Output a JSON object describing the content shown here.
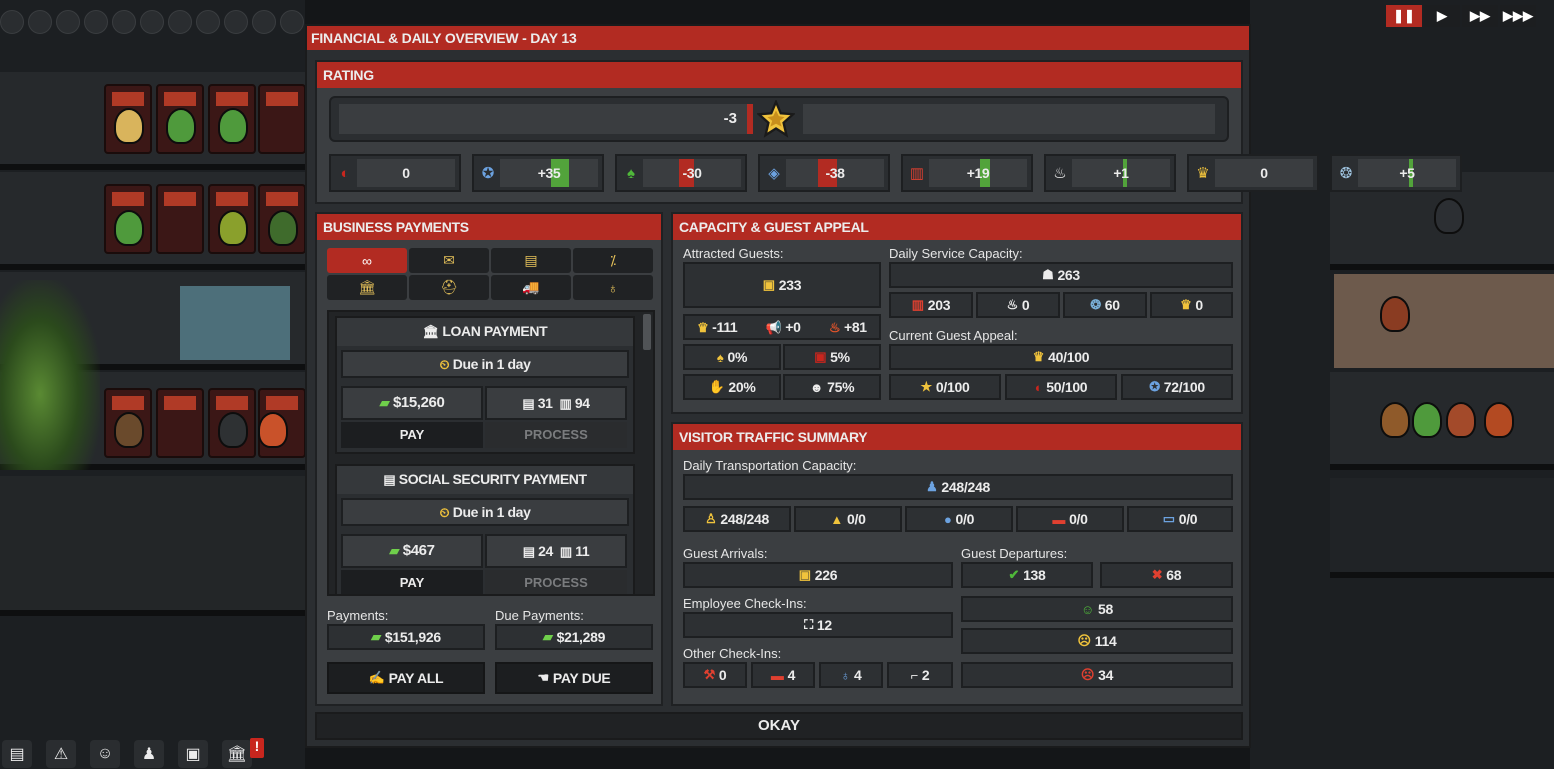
{
  "game": {
    "speed_controls": [
      "❚❚",
      "▶",
      "▶▶",
      "▶▶▶"
    ],
    "speed_active": 0,
    "alert_mark": "!"
  },
  "modal": {
    "title": "FINANCIAL & DAILY OVERVIEW - DAY 13",
    "okay_label": "OKAY"
  },
  "rating": {
    "title": "RATING",
    "overall": "-3",
    "overall_value": -3,
    "stats": [
      {
        "icon": "faction-icon",
        "glyph": "◐",
        "value": "0",
        "bar": 0
      },
      {
        "icon": "police-badge-icon",
        "glyph": "✪",
        "value": "+35",
        "bar": 35
      },
      {
        "icon": "leaf-icon",
        "glyph": "♠",
        "value": "-30",
        "bar": -30
      },
      {
        "icon": "diamond-icon",
        "glyph": "◈",
        "value": "-38",
        "bar": -38
      },
      {
        "icon": "popcorn-icon",
        "glyph": "▥",
        "value": "+19",
        "bar": 19
      },
      {
        "icon": "chef-hat-icon",
        "glyph": "♨",
        "value": "+1",
        "bar": 1
      },
      {
        "icon": "cake-icon",
        "glyph": "♛",
        "value": "0",
        "bar": 0
      },
      {
        "icon": "brain-icon",
        "glyph": "❂",
        "value": "+5",
        "bar": 5
      }
    ]
  },
  "business": {
    "title": "BUSINESS PAYMENTS",
    "tabs": [
      "∞",
      "✉",
      "▤",
      "⁒",
      "🏛",
      "⛑",
      "🚚",
      "♁"
    ],
    "active_tab": 0,
    "cards": [
      {
        "title": "LOAN PAYMENT",
        "title_icon": "🏛",
        "due": "Due in 1 day",
        "amount": "$15,260",
        "doc_a": "31",
        "doc_b": "94",
        "pay": "PAY",
        "process": "PROCESS"
      },
      {
        "title": "SOCIAL SECURITY PAYMENT",
        "title_icon": "▤",
        "due": "Due in 1 day",
        "amount": "$467",
        "doc_a": "24",
        "doc_b": "11",
        "pay": "PAY",
        "process": "PROCESS"
      }
    ],
    "payments_label": "Payments:",
    "payments_value": "$151,926",
    "due_label": "Due Payments:",
    "due_value": "$21,289",
    "pay_all": "PAY ALL",
    "pay_due": "PAY DUE"
  },
  "capacity": {
    "title": "CAPACITY & GUEST APPEAL",
    "attracted_label": "Attracted Guests:",
    "attracted_value": "233",
    "crown": "-111",
    "megaphone": "+0",
    "fire": "+81",
    "pct_a": "0%",
    "pct_b": "5%",
    "pct_c": "20%",
    "pct_d": "75%",
    "daily_label": "Daily Service Capacity:",
    "daily_value": "263",
    "svc_a": "203",
    "svc_b": "0",
    "svc_c": "60",
    "svc_d": "0",
    "appeal_label": "Current Guest Appeal:",
    "appeal_value": "40/100",
    "appeal_a": "0/100",
    "appeal_b": "50/100",
    "appeal_c": "72/100"
  },
  "traffic": {
    "title": "VISITOR TRAFFIC SUMMARY",
    "transport_label": "Daily Transportation Capacity:",
    "transport_value": "248/248",
    "t_walk": "248/248",
    "t_taxi": "0/0",
    "t_car": "0/0",
    "t_bus": "0/0",
    "t_train": "0/0",
    "arrivals_label": "Guest Arrivals:",
    "arrivals_value": "226",
    "departures_label": "Guest Departures:",
    "dep_ok": "138",
    "dep_fail": "68",
    "employee_label": "Employee Check-Ins:",
    "employee_value": "12",
    "happy": "58",
    "neutral": "114",
    "angry": "34",
    "other_label": "Other Check-Ins:",
    "other_a": "0",
    "other_b": "4",
    "other_c": "4",
    "other_d": "2"
  },
  "colors": {
    "accent_red": "#b22b22",
    "positive_green": "#52a33b",
    "cash_green": "#6fcf4b",
    "gold": "#f0c33c"
  }
}
